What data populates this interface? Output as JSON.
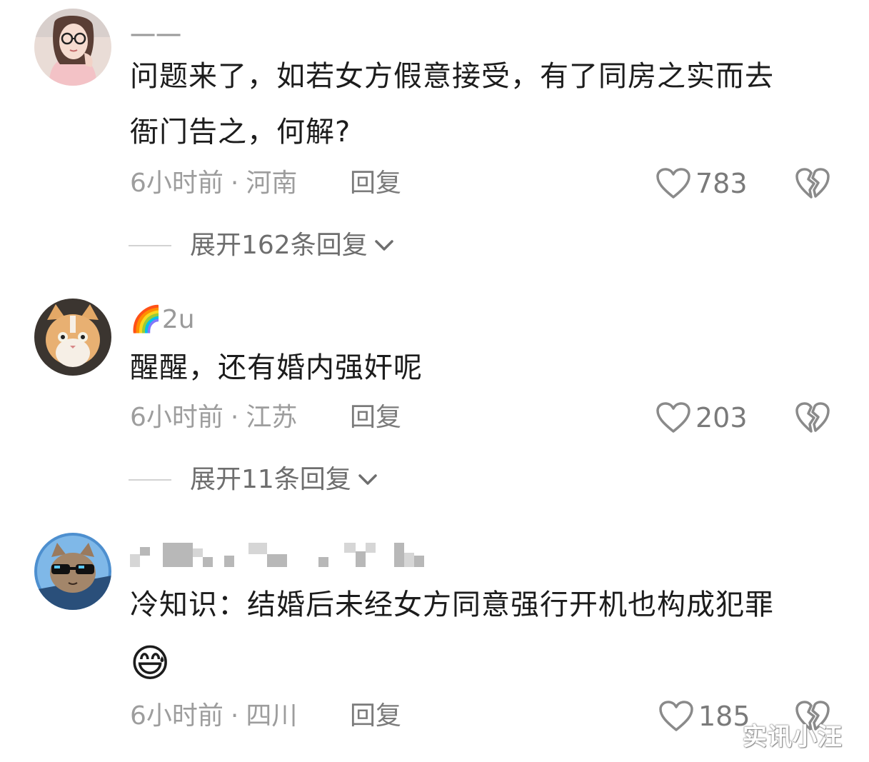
{
  "comments": [
    {
      "username": "一一",
      "text_line1": "问题来了，如若女方假意接受，有了同房之实而去",
      "text_line2": "衙门告之，何解?",
      "time": "6小时前",
      "separator": "·",
      "location": "河南",
      "reply_label": "回复",
      "likes": "783",
      "expand_label": "展开162条回复"
    },
    {
      "username_emoji": "🌈",
      "username": "2u",
      "text_line1": "醒醒，还有婚内强奸呢",
      "time": "6小时前",
      "separator": "·",
      "location": "江苏",
      "reply_label": "回复",
      "likes": "203",
      "expand_label": "展开11条回复"
    },
    {
      "username": "",
      "text_line1": "冷知识：结婚后未经女方同意强行开机也构成犯罪",
      "emoji": "😅",
      "time": "6小时前",
      "separator": "·",
      "location": "四川",
      "reply_label": "回复",
      "likes": "185"
    }
  ],
  "watermark": "实讯小汪",
  "icons": {
    "like": "heart-outline-icon",
    "dislike": "broken-heart-icon",
    "expand": "chevron-down-icon"
  }
}
